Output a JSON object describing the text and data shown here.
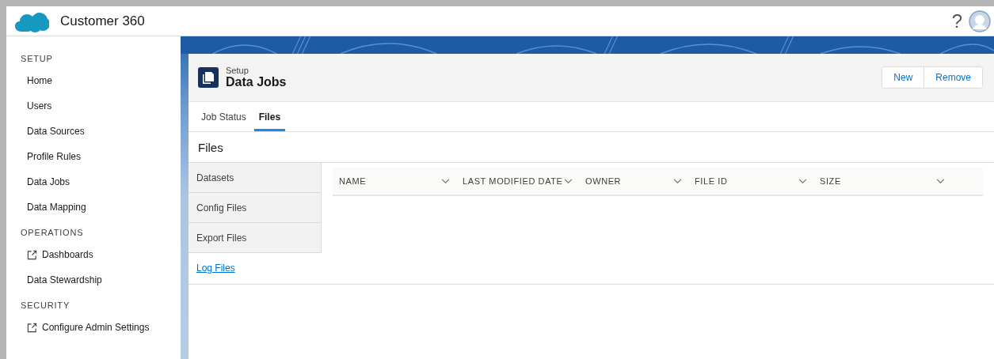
{
  "app": {
    "title": "Customer 360",
    "help": "?"
  },
  "sidebar": {
    "sections": [
      {
        "title": "SETUP",
        "items": [
          {
            "label": "Home",
            "external": false
          },
          {
            "label": "Users",
            "external": false
          },
          {
            "label": "Data Sources",
            "external": false
          },
          {
            "label": "Profile Rules",
            "external": false
          },
          {
            "label": "Data Jobs",
            "external": false
          },
          {
            "label": "Data Mapping",
            "external": false
          }
        ]
      },
      {
        "title": "OPERATIONS",
        "items": [
          {
            "label": "Dashboards",
            "external": true
          },
          {
            "label": "Data Stewardship",
            "external": false
          }
        ]
      },
      {
        "title": "SECURITY",
        "items": [
          {
            "label": "Configure Admin Settings",
            "external": true
          }
        ]
      }
    ]
  },
  "page_header": {
    "eyebrow": "Setup",
    "title": "Data Jobs",
    "buttons": [
      "New",
      "Remove"
    ]
  },
  "tabs": [
    {
      "label": "Job Status",
      "selected": false
    },
    {
      "label": "Files",
      "selected": true
    }
  ],
  "section_title": "Files",
  "file_nav": [
    {
      "label": "Datasets",
      "selected": false
    },
    {
      "label": "Config Files",
      "selected": false
    },
    {
      "label": "Export Files",
      "selected": false
    },
    {
      "label": "Log Files",
      "selected": true
    }
  ],
  "table": {
    "columns": [
      "NAME",
      "LAST MODIFIED DATE",
      "OWNER",
      "FILE ID",
      "SIZE"
    ]
  }
}
